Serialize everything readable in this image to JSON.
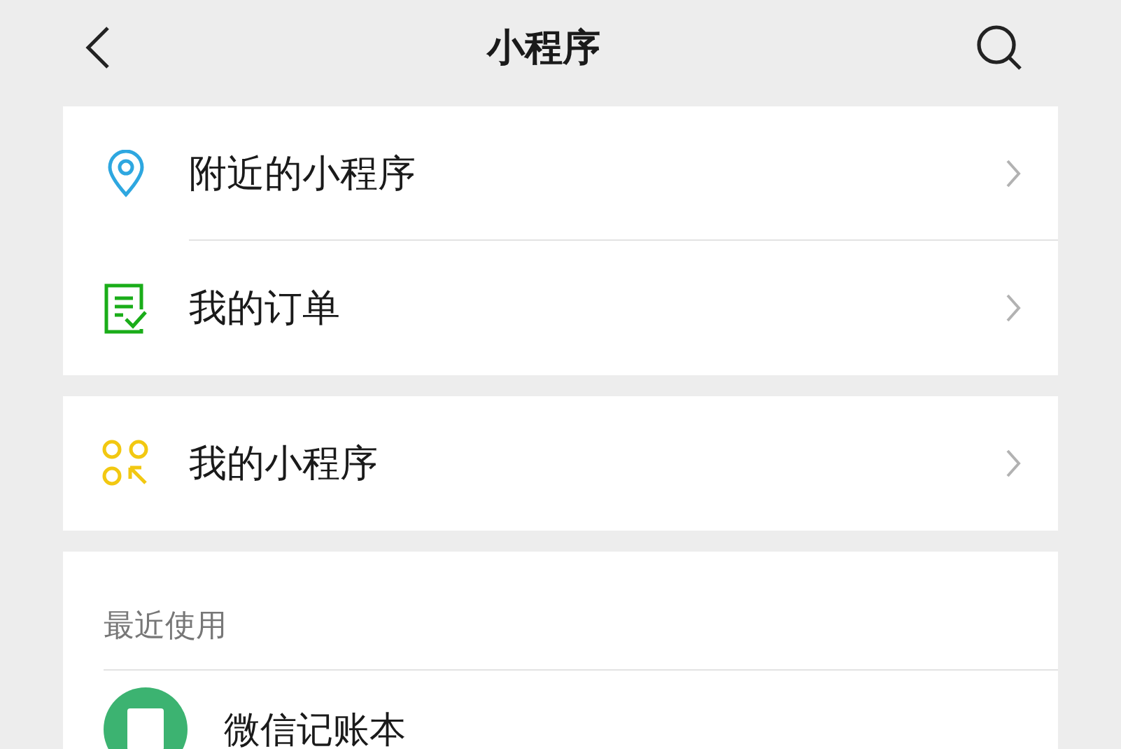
{
  "header": {
    "title": "小程序"
  },
  "menu_groups": [
    {
      "items": [
        {
          "label": "附近的小程序",
          "kind": "location"
        },
        {
          "label": "我的订单",
          "kind": "order"
        }
      ]
    },
    {
      "items": [
        {
          "label": "我的小程序",
          "kind": "apps"
        }
      ]
    }
  ],
  "recent": {
    "heading": "最近使用",
    "items": [
      {
        "label": "微信记账本",
        "color": "#3cb371"
      }
    ]
  }
}
